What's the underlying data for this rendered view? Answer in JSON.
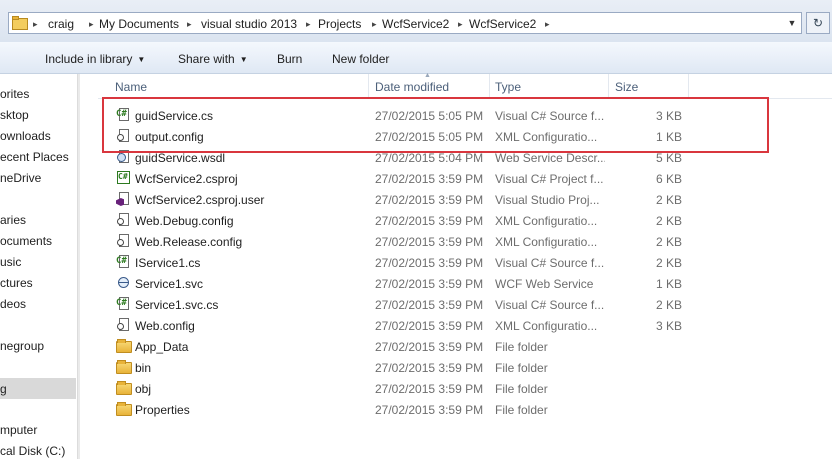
{
  "address": {
    "crumbs": [
      "craig",
      "My Documents",
      "visual studio 2013",
      "Projects",
      "WcfService2",
      "WcfService2"
    ],
    "separator": "▸",
    "dropdown": "▼",
    "refresh": "↻"
  },
  "toolbar": {
    "organize_hidden": "",
    "include_label": "Include in library",
    "share_label": "Share with",
    "burn_label": "Burn",
    "newfolder_label": "New folder",
    "arrow": "▼"
  },
  "nav": {
    "items": [
      "orites",
      "sktop",
      "ownloads",
      "ecent Places",
      "neDrive",
      "aries",
      "ocuments",
      "usic",
      "ctures",
      "deos",
      "negroup",
      "g",
      "mputer",
      "cal Disk (C:)"
    ],
    "scroll_up": "▲"
  },
  "columns": {
    "name": "Name",
    "date": "Date modified",
    "type": "Type",
    "size": "Size",
    "sort_arrow": "▲"
  },
  "files": [
    {
      "name": "guidService.cs",
      "date": "27/02/2015 5:05 PM",
      "type": "Visual C# Source f...",
      "size": "3 KB",
      "icon": "cs"
    },
    {
      "name": "output.config",
      "date": "27/02/2015 5:05 PM",
      "type": "XML Configuratio...",
      "size": "1 KB",
      "icon": "config"
    },
    {
      "name": "guidService.wsdl",
      "date": "27/02/2015 5:04 PM",
      "type": "Web Service Descr...",
      "size": "5 KB",
      "icon": "wsdl"
    },
    {
      "name": "WcfService2.csproj",
      "date": "27/02/2015 3:59 PM",
      "type": "Visual C# Project f...",
      "size": "6 KB",
      "icon": "csproj"
    },
    {
      "name": "WcfService2.csproj.user",
      "date": "27/02/2015 3:59 PM",
      "type": "Visual Studio Proj...",
      "size": "2 KB",
      "icon": "vs"
    },
    {
      "name": "Web.Debug.config",
      "date": "27/02/2015 3:59 PM",
      "type": "XML Configuratio...",
      "size": "2 KB",
      "icon": "config"
    },
    {
      "name": "Web.Release.config",
      "date": "27/02/2015 3:59 PM",
      "type": "XML Configuratio...",
      "size": "2 KB",
      "icon": "config"
    },
    {
      "name": "IService1.cs",
      "date": "27/02/2015 3:59 PM",
      "type": "Visual C# Source f...",
      "size": "2 KB",
      "icon": "cs"
    },
    {
      "name": "Service1.svc",
      "date": "27/02/2015 3:59 PM",
      "type": "WCF Web Service",
      "size": "1 KB",
      "icon": "svc"
    },
    {
      "name": "Service1.svc.cs",
      "date": "27/02/2015 3:59 PM",
      "type": "Visual C# Source f...",
      "size": "2 KB",
      "icon": "cs"
    },
    {
      "name": "Web.config",
      "date": "27/02/2015 3:59 PM",
      "type": "XML Configuratio...",
      "size": "3 KB",
      "icon": "config"
    },
    {
      "name": "App_Data",
      "date": "27/02/2015 3:59 PM",
      "type": "File folder",
      "size": "",
      "icon": "folder"
    },
    {
      "name": "bin",
      "date": "27/02/2015 3:59 PM",
      "type": "File folder",
      "size": "",
      "icon": "folder"
    },
    {
      "name": "obj",
      "date": "27/02/2015 3:59 PM",
      "type": "File folder",
      "size": "",
      "icon": "folder"
    },
    {
      "name": "Properties",
      "date": "27/02/2015 3:59 PM",
      "type": "File folder",
      "size": "",
      "icon": "folder"
    }
  ],
  "icons": {
    "cs_glyph": "C#",
    "csproj_glyph": "C#",
    "colors": {
      "cs": "#2c7a1f",
      "vs": "#68217a",
      "highlight": "#d9363e"
    }
  }
}
